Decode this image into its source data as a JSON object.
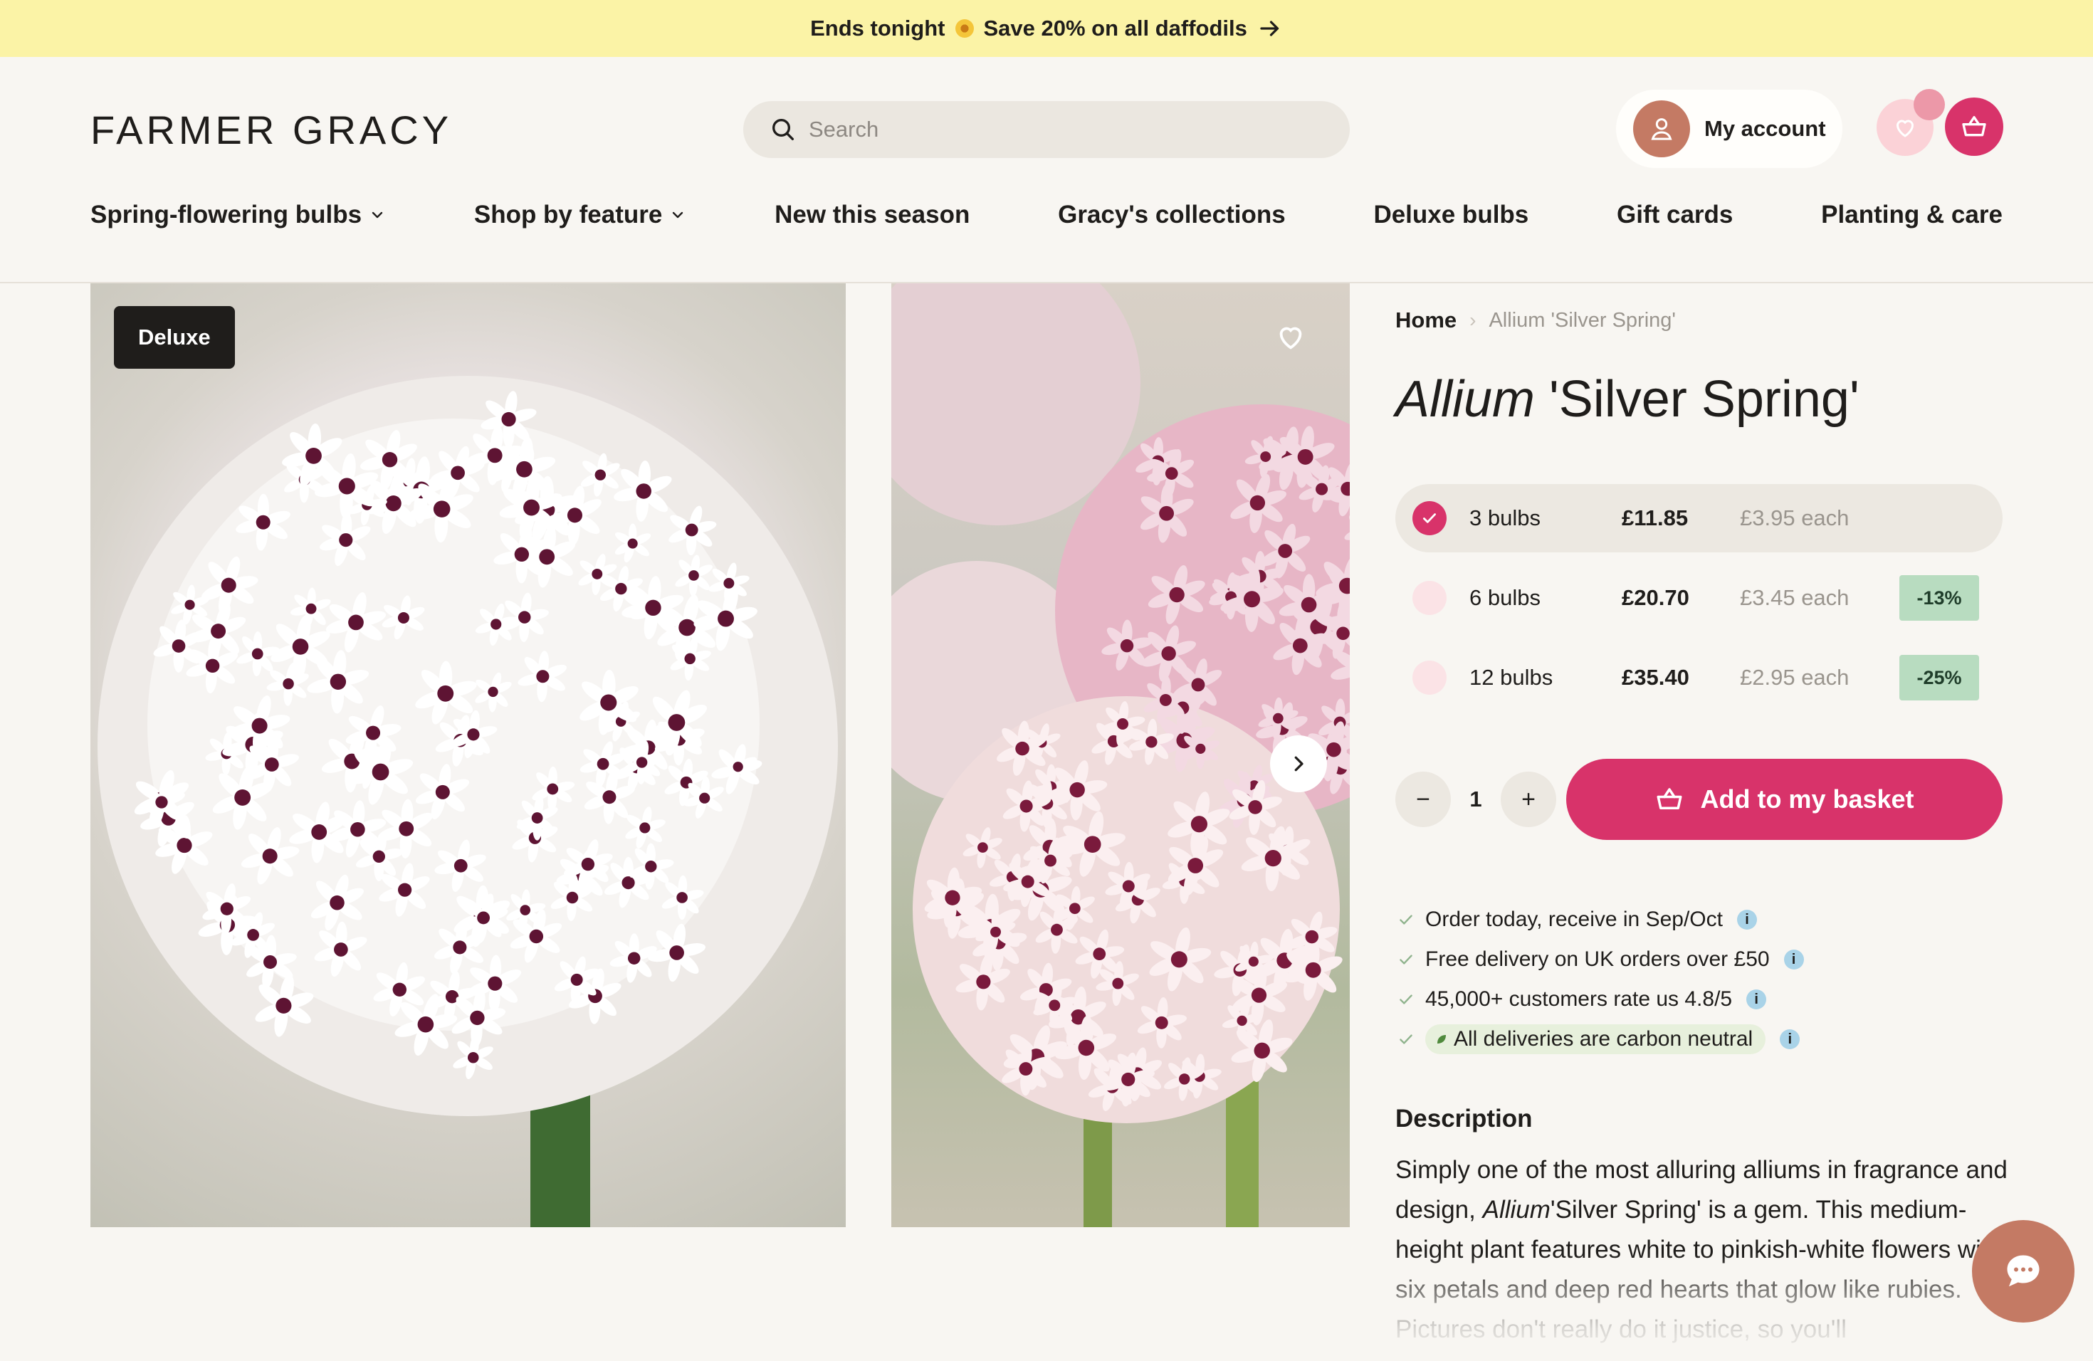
{
  "colors": {
    "accent": "#d8336a",
    "banner": "#fbf3a6",
    "save_badge": "#b8dcc0",
    "avatar": "#c47a64",
    "info": "#a9d3e8"
  },
  "promo": {
    "part1": "Ends tonight",
    "icon": "daffodil-icon",
    "part2": "Save 20% on all daffodils"
  },
  "header": {
    "logo": "FARMER GRACY",
    "search_placeholder": "Search",
    "account_label": "My account"
  },
  "nav": {
    "items": [
      {
        "label": "Spring-flowering bulbs",
        "dropdown": true
      },
      {
        "label": "Shop by feature",
        "dropdown": true
      },
      {
        "label": "New this season",
        "dropdown": false
      },
      {
        "label": "Gracy's collections",
        "dropdown": false
      },
      {
        "label": "Deluxe bulbs",
        "dropdown": false
      },
      {
        "label": "Gift cards",
        "dropdown": false
      },
      {
        "label": "Planting & care",
        "dropdown": false
      }
    ]
  },
  "gallery": {
    "badge": "Deluxe"
  },
  "breadcrumb": {
    "home": "Home",
    "current": "Allium 'Silver Spring'"
  },
  "product": {
    "title_italic": "Allium",
    "title_rest": " 'Silver Spring'",
    "options": [
      {
        "qty": "3 bulbs",
        "price": "£11.85",
        "each": "£3.95 each",
        "saving": "",
        "selected": true
      },
      {
        "qty": "6 bulbs",
        "price": "£20.70",
        "each": "£3.45 each",
        "saving": "-13%",
        "selected": false
      },
      {
        "qty": "12 bulbs",
        "price": "£35.40",
        "each": "£2.95 each",
        "saving": "-25%",
        "selected": false
      }
    ],
    "quantity": "1",
    "decrement": "−",
    "increment": "+",
    "add_label": "Add to my basket"
  },
  "perks": [
    "Order today, receive in Sep/Oct",
    "Free delivery on UK orders over £50",
    "45,000+ customers rate us 4.8/5",
    "All deliveries are carbon neutral"
  ],
  "info_glyph": "i",
  "description": {
    "heading": "Description",
    "text_before": "Simply one of the most alluring alliums in fragrance and design, ",
    "text_italic": "Allium",
    "text_after": "'Silver Spring' is a gem. This medium-height plant features white to pinkish-white flowers with six petals and deep red hearts that glow like rubies. Pictures don't really do it justice, so you'll"
  }
}
